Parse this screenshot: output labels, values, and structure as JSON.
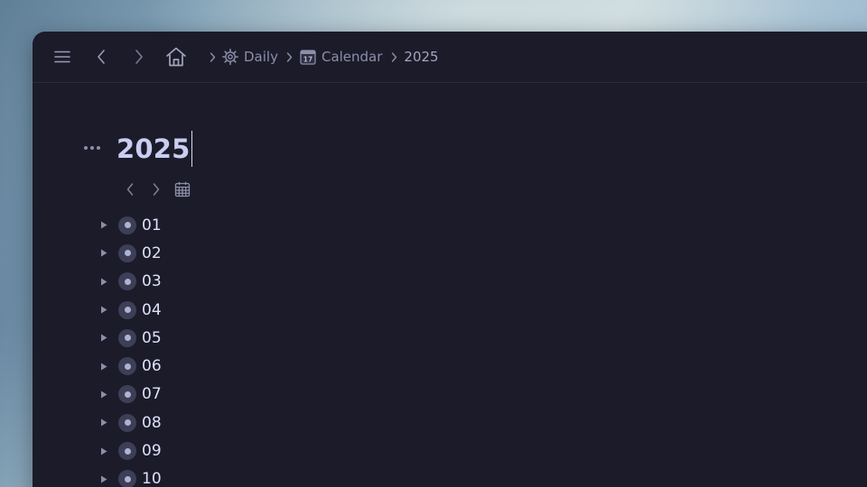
{
  "topbar": {
    "menu_icon": "hamburger-icon",
    "back_icon": "chevron-left-icon",
    "forward_icon": "chevron-right-icon",
    "home_icon": "home-icon",
    "breadcrumbs": [
      {
        "label": "Daily",
        "icon": "gear-icon"
      },
      {
        "label": "Calendar",
        "icon": "calendar-17-icon"
      },
      {
        "label": "2025",
        "icon": ""
      }
    ]
  },
  "document": {
    "title": "2025",
    "tools": [
      "chevron-left-icon",
      "chevron-right-icon",
      "calendar-grid-icon"
    ]
  },
  "outline": {
    "items": [
      {
        "label": "01"
      },
      {
        "label": "02"
      },
      {
        "label": "03"
      },
      {
        "label": "04"
      },
      {
        "label": "05"
      },
      {
        "label": "06"
      },
      {
        "label": "07"
      },
      {
        "label": "08"
      },
      {
        "label": "09"
      },
      {
        "label": "10"
      }
    ]
  },
  "colors": {
    "window_bg": "#1b1b2a",
    "title": "#c9cdf1",
    "text": "#dfe1f7",
    "muted": "#8d8ea8",
    "bullet_bg": "#3d3f57",
    "bullet_dot": "#aeb3d3"
  }
}
